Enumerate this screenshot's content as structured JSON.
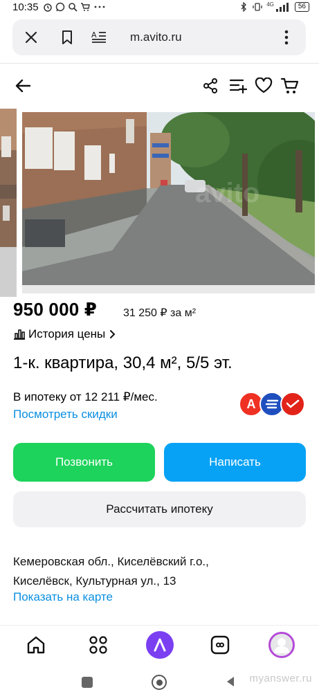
{
  "status": {
    "time": "10:35",
    "network": "4G",
    "battery": "56"
  },
  "browser": {
    "url": "m.avito.ru",
    "icons": [
      "close-icon",
      "bookmark-icon",
      "reader-mode-icon",
      "more-vertical-icon"
    ]
  },
  "header": {
    "icons": [
      "back-arrow-icon",
      "share-icon",
      "compare-icon",
      "favorite-heart-icon",
      "cart-icon"
    ]
  },
  "gallery": {
    "watermark": "avito"
  },
  "listing": {
    "price": "950 000 ₽",
    "price_per_sqm": "31 250 ₽ за м²",
    "history_label": "История цены",
    "title": "1-к. квартира, 30,4 м², 5/5 эт.",
    "mortgage_text": "В ипотеку от 12 211 ₽/мес.",
    "discounts_link": "Посмотреть скидки",
    "banks": [
      {
        "letter": "А",
        "color": "#ef3124"
      },
      {
        "letter": "≡",
        "color": "#1f4fbf"
      },
      {
        "letter": "✓",
        "color": "#e2231a"
      }
    ]
  },
  "actions": {
    "call": "Позвонить",
    "write": "Написать",
    "mortgage_calc": "Рассчитать ипотеку"
  },
  "location": {
    "address_line1": "Кемеровская обл., Киселёвский г.о.,",
    "address_line2": "Киселёвск, Культурная ул., 13",
    "map_link": "Показать на карте"
  },
  "bottom_nav": {
    "items": [
      "home-icon",
      "services-grid-icon",
      "alice-assistant-icon",
      "messenger-icon",
      "profile-avatar-icon"
    ]
  },
  "watermark": "myanswer.ru",
  "colors": {
    "green": "#1dd35b",
    "blue": "#07a2f5",
    "link": "#0a8fe0",
    "alice": "#7b3ff2"
  }
}
